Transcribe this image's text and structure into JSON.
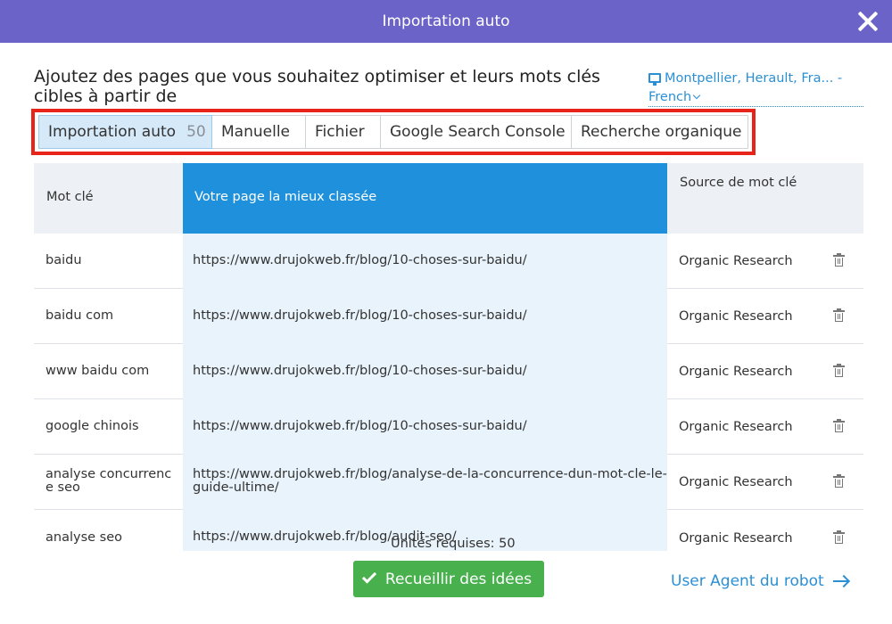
{
  "window": {
    "title": "Importation auto"
  },
  "heading": "Ajoutez des pages que vous souhaitez optimiser et leurs mots clés cibles à partir de",
  "location": {
    "line1": "Montpellier, Herault, Fra... -",
    "line2": "French",
    "icon": "desktop-icon"
  },
  "tabs": [
    {
      "label": "Importation auto",
      "count": "50",
      "active": true
    },
    {
      "label": "Manuelle"
    },
    {
      "label": "Fichier"
    },
    {
      "label": "Google Search Console"
    },
    {
      "label": "Recherche organique"
    }
  ],
  "table": {
    "headers": {
      "keyword": "Mot clé",
      "page": "Votre page la mieux classée",
      "source": "Source de mot clé"
    },
    "rows": [
      {
        "keyword": "baidu",
        "page": "https://www.drujokweb.fr/blog/10-choses-sur-baidu/",
        "source": "Organic Research"
      },
      {
        "keyword": "baidu com",
        "page": "https://www.drujokweb.fr/blog/10-choses-sur-baidu/",
        "source": "Organic Research"
      },
      {
        "keyword": "www baidu com",
        "page": "https://www.drujokweb.fr/blog/10-choses-sur-baidu/",
        "source": "Organic Research"
      },
      {
        "keyword": "google chinois",
        "page": "https://www.drujokweb.fr/blog/10-choses-sur-baidu/",
        "source": "Organic Research"
      },
      {
        "keyword": "analyse concurrenc e seo",
        "page": "https://www.drujokweb.fr/blog/analyse-de-la-concurrence-dun-mot-cle-le-guide-ultime/",
        "source": "Organic Research"
      },
      {
        "keyword": "analyse seo",
        "page": "https://www.drujokweb.fr/blog/audit-seo/",
        "source": "Organic Research"
      }
    ]
  },
  "footer": {
    "units": "Unités requises: 50",
    "collect_button": "Recueillir des idées",
    "agent_link": "User Agent du robot"
  },
  "colors": {
    "titlebar": "#6b63c8",
    "accent_blue": "#1f90db",
    "highlight_red": "#e8231a",
    "button_green": "#48b04c"
  }
}
